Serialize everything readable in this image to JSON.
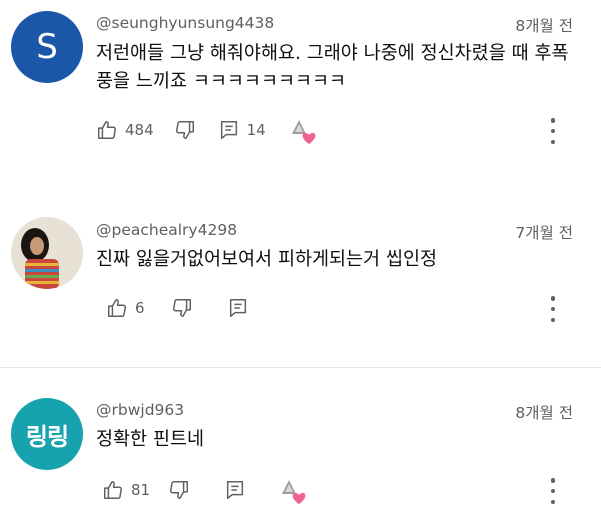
{
  "comments": [
    {
      "handle": "@seunghyunsung4438",
      "time": "8개월 전",
      "avatar_letter": "S",
      "avatar_color": "#1a57a8",
      "text": "저런애들 그냥 해줘야해요. 그래야 나중에 정신차렸을 때 후폭풍을 느끼죠 ㅋㅋㅋㅋㅋㅋㅋㅋㅋ",
      "likes": "484",
      "replies": "14",
      "creator_heart": true
    },
    {
      "handle": "@peachealry4298",
      "time": "7개월 전",
      "avatar_type": "photo",
      "text": "진짜 잃을거없어보여서 피하게되는거 씹인정",
      "likes": "6",
      "replies": "",
      "creator_heart": false
    },
    {
      "handle": "@rbwjd963",
      "time": "8개월 전",
      "avatar_text": "링링",
      "avatar_color": "#17a3ad",
      "text": "정확한 핀트네",
      "likes": "81",
      "replies": "",
      "creator_heart": true
    }
  ],
  "colors": {
    "meta": "#606060",
    "text": "#0f0f0f",
    "divider": "#e5e5e5",
    "heart": "#f06292"
  }
}
